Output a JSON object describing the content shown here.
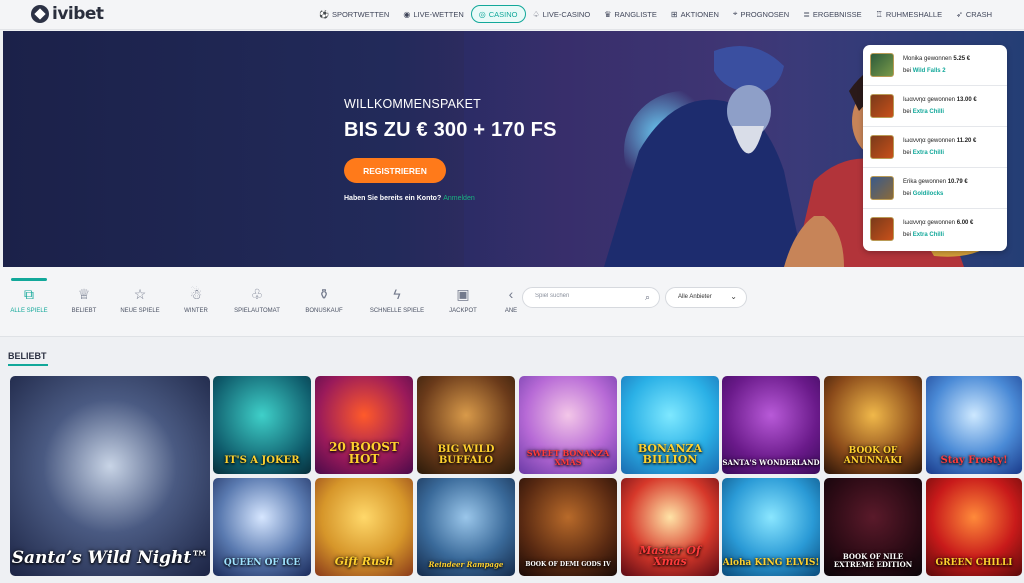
{
  "header": {
    "logo_text": "ivibet",
    "nav": [
      {
        "label": "SPORTWETTEN",
        "icon": "soccer-ball-icon",
        "glyph": "⚽"
      },
      {
        "label": "LIVE-WETTEN",
        "icon": "live-icon",
        "glyph": "◉"
      },
      {
        "label": "CASINO",
        "icon": "casino-chip-icon",
        "glyph": "◎",
        "active": true
      },
      {
        "label": "LIVE-CASINO",
        "icon": "cards-icon",
        "glyph": "♤"
      },
      {
        "label": "RANGLISTE",
        "icon": "ranking-icon",
        "glyph": "♛"
      },
      {
        "label": "AKTIONEN",
        "icon": "gift-icon",
        "glyph": "⊞"
      },
      {
        "label": "PROGNOSEN",
        "icon": "forecast-icon",
        "glyph": "⌖"
      },
      {
        "label": "ERGEBNISSE",
        "icon": "results-icon",
        "glyph": "≣"
      },
      {
        "label": "RUHMESHALLE",
        "icon": "trophy-icon",
        "glyph": "♖"
      },
      {
        "label": "CRASH",
        "icon": "rocket-icon",
        "glyph": "➶"
      }
    ]
  },
  "hero": {
    "welcome": "WILLKOMMENSPAKET",
    "amount": "BIS ZU € 300 + 170 FS",
    "register": "REGISTRIEREN",
    "account_question": "Haben Sie bereits ein Konto?",
    "login": "Anmelden"
  },
  "winners": [
    {
      "name": "Monika",
      "verb": "gewonnen",
      "amount": "5.25 €",
      "prep": "bei",
      "game": "Wild Falls 2"
    },
    {
      "name": "Ιωαννηα",
      "verb": "gewonnen",
      "amount": "13.00 €",
      "prep": "bei",
      "game": "Extra Chilli"
    },
    {
      "name": "Ιωαννηα",
      "verb": "gewonnen",
      "amount": "11.20 €",
      "prep": "bei",
      "game": "Extra Chilli"
    },
    {
      "name": "Erika",
      "verb": "gewonnen",
      "amount": "10.79 €",
      "prep": "bei",
      "game": "Goldilocks"
    },
    {
      "name": "Ιωαννηα",
      "verb": "gewonnen",
      "amount": "6.00 €",
      "prep": "bei",
      "game": "Extra Chilli"
    }
  ],
  "categories": [
    {
      "label": "ALLE SPIELE",
      "icon": "all-games-icon",
      "glyph": "⧉",
      "active": true
    },
    {
      "label": "BELIEBT",
      "icon": "crown-icon",
      "glyph": "♕"
    },
    {
      "label": "NEUE SPIELE",
      "icon": "star-icon",
      "glyph": "☆"
    },
    {
      "label": "WINTER",
      "icon": "snowman-icon",
      "glyph": "☃"
    },
    {
      "label": "SPIELAUTOMAT",
      "icon": "cherries-icon",
      "glyph": "♧"
    },
    {
      "label": "BONUSKAUF",
      "icon": "money-bag-icon",
      "glyph": "⚱"
    },
    {
      "label": "SCHNELLE SPIELE",
      "icon": "lightning-icon",
      "glyph": "ϟ"
    },
    {
      "label": "JACKPOT",
      "icon": "jackpot-icon",
      "glyph": "▣"
    },
    {
      "label": "ANE",
      "icon": "more-icon",
      "glyph": "‹"
    }
  ],
  "search": {
    "placeholder": "Spiel suchen"
  },
  "provider": {
    "label": "Alle Anbieter"
  },
  "section": {
    "title": "BELIEBT"
  },
  "games": [
    {
      "title": "Santa’s Wild Night™",
      "style": "white"
    },
    {
      "title": "IT'S A JOKER",
      "style": "yellow"
    },
    {
      "title": "20 BOOST HOT",
      "style": "yellow"
    },
    {
      "title": "BIG WILD BUFFALO",
      "style": "yellow"
    },
    {
      "title": "SWEET BONANZA XMAS",
      "style": "red"
    },
    {
      "title": "BONANZA BILLION",
      "style": "yellow"
    },
    {
      "title": "SANTA'S WONDERLAND",
      "style": "white"
    },
    {
      "title": "BOOK OF ANUNNAKI",
      "style": "yellow"
    },
    {
      "title": "Stay Frosty!",
      "style": "red"
    },
    {
      "title": "QUEEN OF ICE",
      "style": "blue"
    },
    {
      "title": "Gift Rush",
      "style": "yellow"
    },
    {
      "title": "Reindeer Rampage",
      "style": "yellow"
    },
    {
      "title": "BOOK OF DEMI GODS IV",
      "style": "white"
    },
    {
      "title": "Master Of Xmas",
      "style": "red"
    },
    {
      "title": "Aloha KING ELVIS!",
      "style": "yellow"
    },
    {
      "title": "BOOK OF NILE EXTREME EDITION",
      "style": "white"
    },
    {
      "title": "GREEN CHILLI",
      "style": "yellow"
    }
  ]
}
